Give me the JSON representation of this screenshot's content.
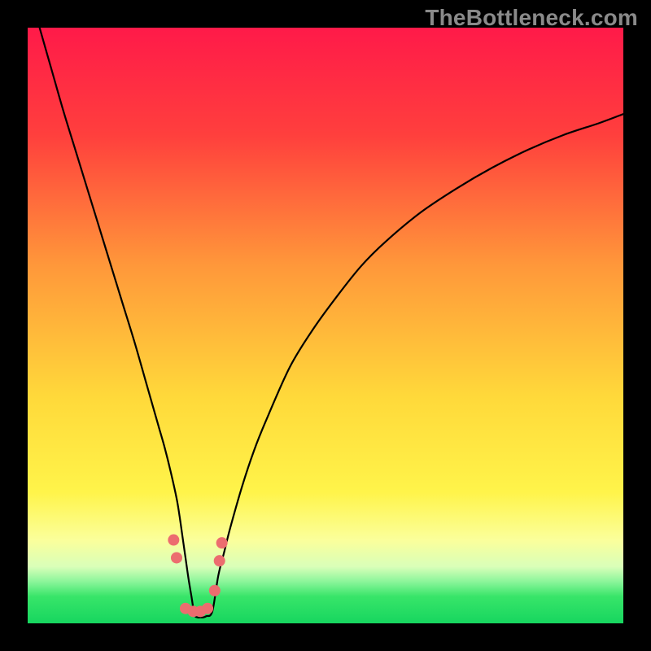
{
  "watermark": "TheBottleneck.com",
  "chart_data": {
    "type": "line",
    "title": "",
    "xlabel": "",
    "ylabel": "",
    "xlim": [
      0,
      100
    ],
    "ylim": [
      0,
      100
    ],
    "background_gradient_stops": [
      {
        "offset": 0.0,
        "color": "#ff1a49"
      },
      {
        "offset": 0.18,
        "color": "#ff3f3d"
      },
      {
        "offset": 0.4,
        "color": "#ff983a"
      },
      {
        "offset": 0.62,
        "color": "#ffd93a"
      },
      {
        "offset": 0.78,
        "color": "#fff44a"
      },
      {
        "offset": 0.86,
        "color": "#fbff9b"
      },
      {
        "offset": 0.905,
        "color": "#d9ffb9"
      },
      {
        "offset": 0.93,
        "color": "#8bf59a"
      },
      {
        "offset": 0.955,
        "color": "#38e569"
      },
      {
        "offset": 1.0,
        "color": "#17d65f"
      }
    ],
    "series": [
      {
        "name": "bottleneck-curve",
        "x": [
          2,
          4,
          6,
          8,
          10,
          12,
          14,
          16,
          18,
          20,
          21,
          22,
          23,
          24,
          25,
          25.5,
          26,
          26.5,
          27,
          27.5,
          28,
          28.5,
          29,
          29.5,
          30,
          31,
          32,
          33,
          34,
          36,
          38,
          40,
          44,
          48,
          52,
          56,
          60,
          66,
          72,
          78,
          84,
          90,
          96,
          100
        ],
        "y": [
          100,
          93,
          86,
          79.5,
          73,
          66.5,
          60,
          53.5,
          47,
          40,
          36.5,
          33,
          29.5,
          25.5,
          21,
          18,
          14.5,
          11,
          7.5,
          4.5,
          1.5,
          1,
          1,
          1,
          1.2,
          2,
          8,
          12,
          16,
          23,
          29,
          34,
          43,
          49.5,
          55,
          60,
          64,
          69,
          73,
          76.5,
          79.5,
          82,
          84,
          85.5
        ]
      }
    ],
    "markers": [
      {
        "x": 24.5,
        "y": 14,
        "r": 7
      },
      {
        "x": 25.0,
        "y": 11,
        "r": 7
      },
      {
        "x": 26.5,
        "y": 2.5,
        "r": 7
      },
      {
        "x": 27.8,
        "y": 2.0,
        "r": 7
      },
      {
        "x": 29.0,
        "y": 2.0,
        "r": 7
      },
      {
        "x": 30.2,
        "y": 2.5,
        "r": 7
      },
      {
        "x": 31.4,
        "y": 5.5,
        "r": 7
      },
      {
        "x": 32.2,
        "y": 10.5,
        "r": 7
      },
      {
        "x": 32.6,
        "y": 13.5,
        "r": 7
      }
    ],
    "marker_color": "#ec6d6f"
  }
}
